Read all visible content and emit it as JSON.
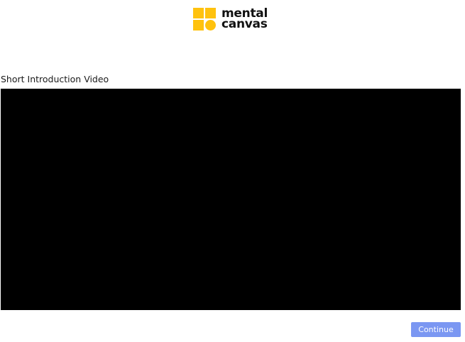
{
  "brand": {
    "line1": "mental",
    "line2": "canvas",
    "logo_color": "#FFC20E",
    "text_color": "#111111"
  },
  "main": {
    "video_title": "Short Introduction Video",
    "video_background": "#000000"
  },
  "footer": {
    "continue_label": "Continue",
    "continue_color": "#7B97F2"
  }
}
